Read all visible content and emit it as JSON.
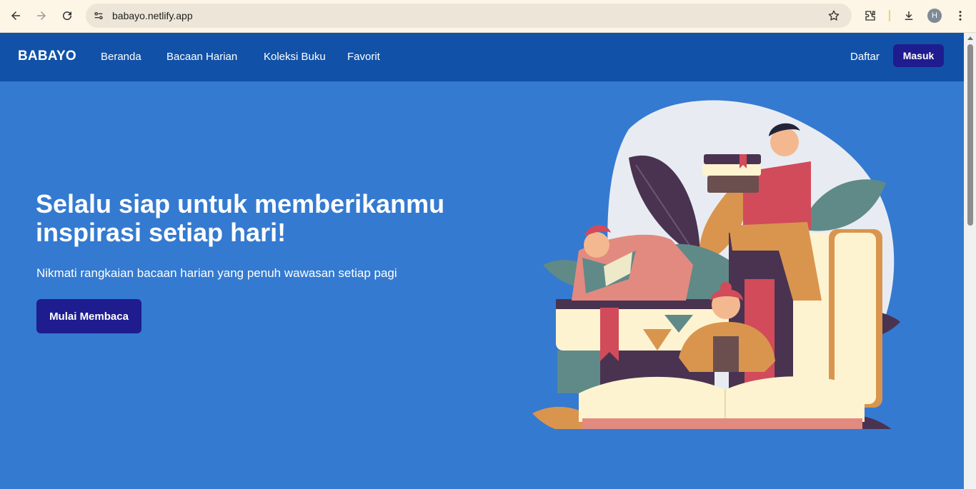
{
  "browser": {
    "url": "babayo.netlify.app",
    "profile_initial": "H"
  },
  "nav": {
    "brand": "BABAYO",
    "links": [
      "Beranda",
      "Bacaan Harian",
      "Koleksi Buku",
      "Favorit"
    ],
    "register": "Daftar",
    "login": "Masuk"
  },
  "hero": {
    "title": "Selalu siap untuk memberikanmu inspirasi setiap hari!",
    "subtitle": "Nikmati rangkaian bacaan harian yang penuh wawasan setiap pagi",
    "cta": "Mulai Membaca"
  },
  "colors": {
    "page_bg": "#347ad0",
    "navbar_bg": "#1152a8",
    "button_bg": "#1f1c8f"
  }
}
